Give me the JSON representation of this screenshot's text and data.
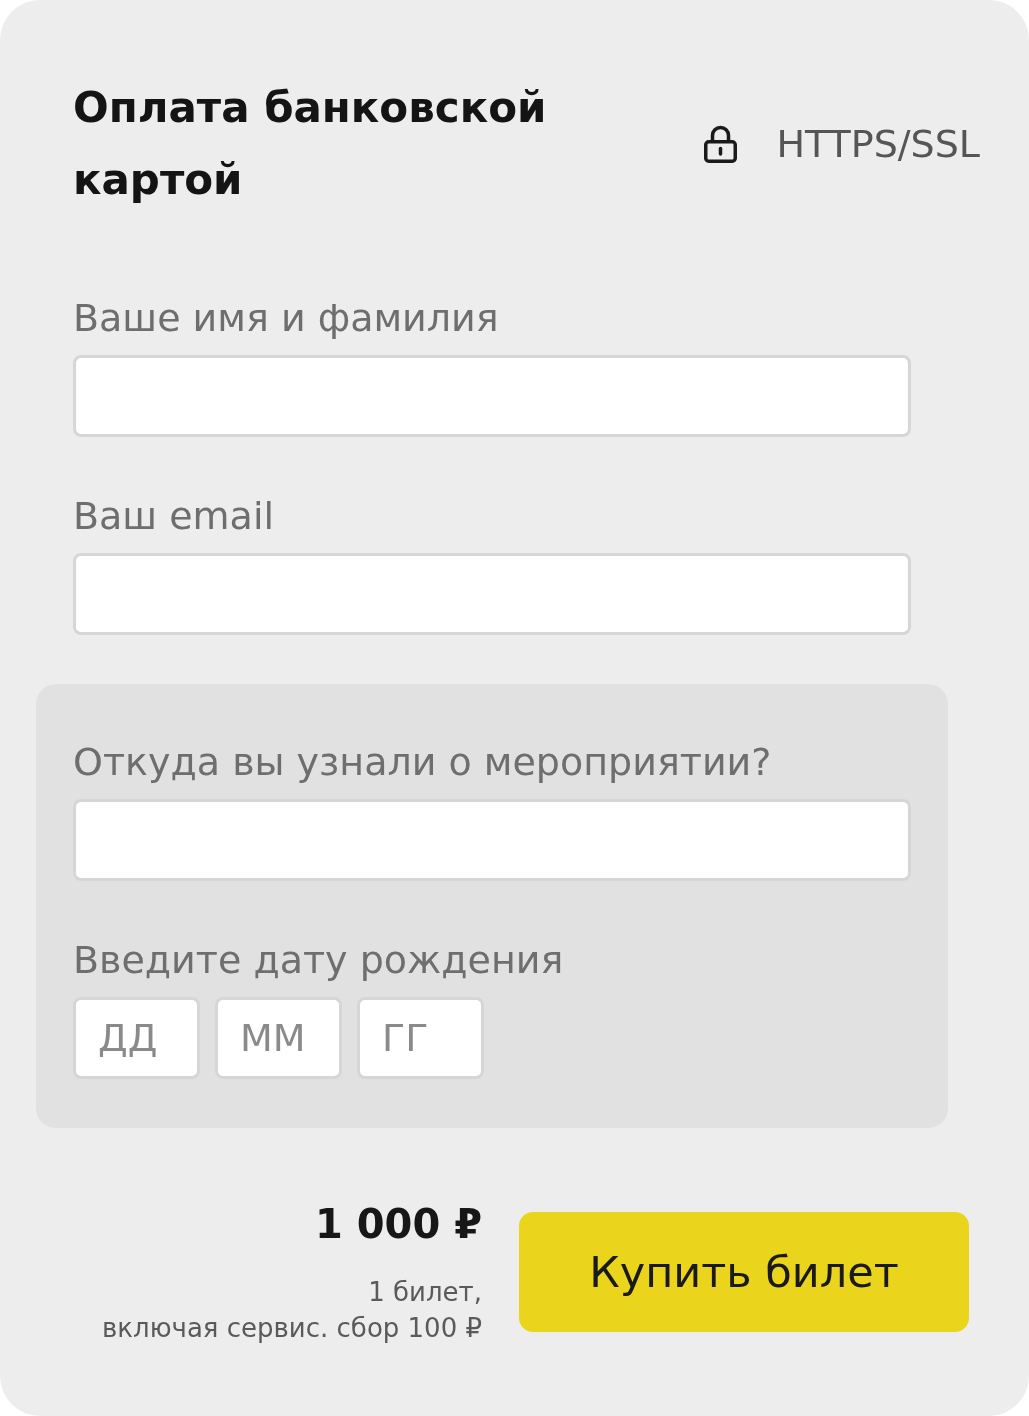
{
  "header": {
    "title": "Оплата банковской картой",
    "security": {
      "label": "HTTPS/SSL"
    }
  },
  "fields": [
    {
      "kind": "text",
      "label": "Ваше имя и фамилия"
    },
    {
      "kind": "text",
      "label": "Ваш email"
    }
  ],
  "optional_section": {
    "fields": [
      {
        "kind": "text",
        "label": "Откуда вы узнали о мероприятии?"
      },
      {
        "kind": "date",
        "label": "Введите дату рождения",
        "parts": [
          {
            "placeholder": "ДД"
          },
          {
            "placeholder": "ММ"
          },
          {
            "placeholder": "ГГ"
          }
        ]
      }
    ]
  },
  "order_summary": {
    "price": "1 000 ₽",
    "note": "1 билет,\nвключая сервис. сбор 100 ₽"
  },
  "buy_button": {
    "label": "Купить билет"
  }
}
